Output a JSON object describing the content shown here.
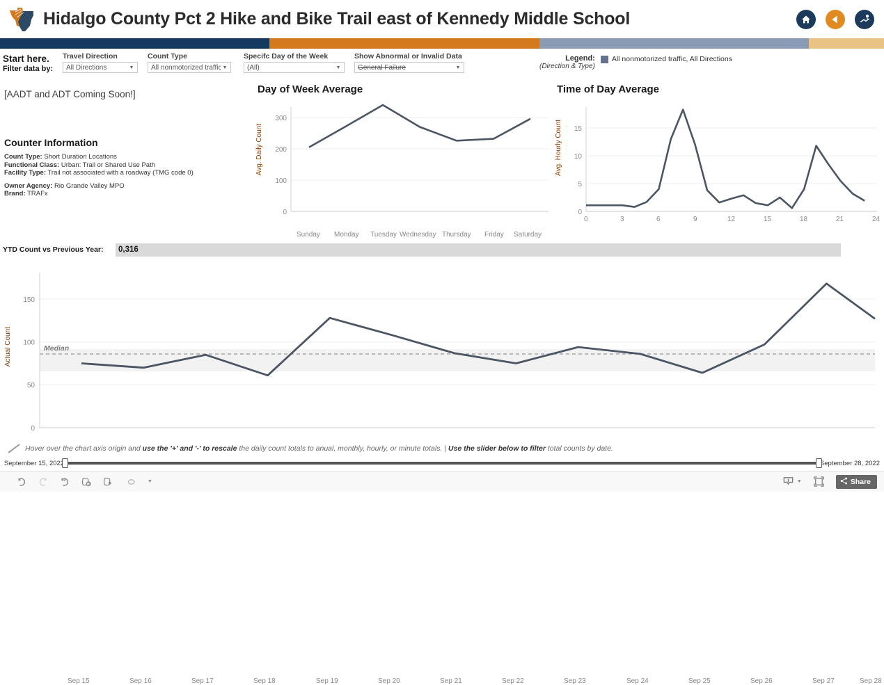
{
  "header": {
    "title": "Hidalgo County Pct 2 Hike and Bike Trail east of Kennedy Middle School",
    "logo_icon": "texas-state-icon",
    "icons": [
      {
        "name": "home-icon",
        "glyph": "home"
      },
      {
        "name": "back-arrow-icon",
        "glyph": "back"
      },
      {
        "name": "map-pin-icon",
        "glyph": "pin"
      }
    ],
    "strip_colors": [
      "#163a5f",
      "#d3791e",
      "#8a9cb5",
      "#e9c286"
    ]
  },
  "filters": {
    "start_here": "Start here.",
    "filter_data_by": "Filter data by:",
    "items": [
      {
        "label": "Travel Direction",
        "value": "All Directions",
        "strike": false
      },
      {
        "label": "Count Type",
        "value": "All nonmotorized traffic",
        "strike": false
      },
      {
        "label": "Specifc Day of the Week",
        "value": "(All)",
        "strike": false
      },
      {
        "label": "Show Abnormal or Invalid Data",
        "value": "General Failure",
        "strike": true
      }
    ]
  },
  "legend": {
    "title": "Legend:",
    "subtitle": "(Direction & Type)",
    "entry_label": "All nonmotorized traffic, All Directions",
    "entry_color": "#63738f"
  },
  "left_panel": {
    "aadt_note": "[AADT and ADT Coming Soon!]",
    "counter_info_title": "Counter Information",
    "rows": [
      {
        "key": "Count Type:",
        "val": " Short Duration Locations"
      },
      {
        "key": "Functional Class:",
        "val": " Urban: Trail or Shared Use Path"
      },
      {
        "key": "Facility Type:",
        "val": " Trail not associated with a roadway (TMG code 0)"
      },
      {
        "key": "Owner Agency:",
        "val": " Rio Grande Valley MPO"
      },
      {
        "key": "Brand:",
        "val": " TRAFx"
      }
    ]
  },
  "ytd": {
    "label": "YTD Count vs Previous Year:",
    "value": "0,316"
  },
  "hint": {
    "icon": "pencil-icon",
    "part1": "Hover over the chart axis origin and ",
    "bold1": "use the '+' and '-' to rescale",
    "part2": " the daily count totals to anual, monthly, hourly, or minute totals.  |  ",
    "bold2": "Use the slider below to filter",
    "part3": " total counts by date."
  },
  "slider": {
    "start_date": "September 15, 2022",
    "end_date": "September 28, 2022"
  },
  "toolbar": {
    "left_icons": [
      {
        "name": "undo-icon"
      },
      {
        "name": "redo-icon"
      },
      {
        "name": "revert-icon"
      },
      {
        "name": "refresh-icon"
      },
      {
        "name": "pause-icon"
      },
      {
        "name": "view-original-icon"
      }
    ],
    "right_icons": [
      {
        "name": "download-icon"
      },
      {
        "name": "fullscreen-icon"
      }
    ],
    "share_label": "Share",
    "share_icon": "share-icon"
  },
  "chart_data": [
    {
      "id": "day_of_week",
      "type": "line",
      "title": "Day of Week Average",
      "xlabel": "",
      "ylabel": "Avg. Daily Count",
      "categories": [
        "Sunday",
        "Monday",
        "Tuesday",
        "Wednesday",
        "Thursday",
        "Friday",
        "Saturday"
      ],
      "values": [
        205,
        272,
        340,
        270,
        226,
        232,
        296
      ],
      "yticks": [
        0,
        100,
        200,
        300
      ],
      "ylim": [
        0,
        350
      ],
      "grid": true,
      "line_color": "#4b5563",
      "legend": "none"
    },
    {
      "id": "time_of_day",
      "type": "line",
      "title": "Time of Day Average",
      "xlabel": "",
      "ylabel": "Avg. Hourly Count",
      "x": [
        0,
        1,
        2,
        3,
        4,
        5,
        6,
        7,
        8,
        9,
        10,
        11,
        12,
        13,
        14,
        15,
        16,
        17,
        18,
        19,
        20,
        21,
        22,
        23
      ],
      "values": [
        1.1,
        1.1,
        1.1,
        1.1,
        0.8,
        1.7,
        4.0,
        13.0,
        18.3,
        12.0,
        3.8,
        1.6,
        2.3,
        2.9,
        1.5,
        1.1,
        2.5,
        0.6,
        4.0,
        11.8,
        8.5,
        5.5,
        3.2,
        1.9
      ],
      "xticks": [
        0,
        3,
        6,
        9,
        12,
        15,
        18,
        21,
        24
      ],
      "yticks": [
        0,
        5,
        10,
        15
      ],
      "ylim": [
        0,
        19
      ],
      "xlim": [
        0,
        24
      ],
      "grid": true,
      "line_color": "#4b5563",
      "legend": "none"
    },
    {
      "id": "daily_actual_count",
      "type": "line",
      "title": "",
      "xlabel": "",
      "ylabel": "Actual Count",
      "categories": [
        "Sep 15",
        "Sep 16",
        "Sep 17",
        "Sep 18",
        "Sep 19",
        "Sep 20",
        "Sep 21",
        "Sep 22",
        "Sep 23",
        "Sep 24",
        "Sep 25",
        "Sep 26",
        "Sep 27",
        "Sep 28"
      ],
      "values": [
        75,
        70,
        85,
        61,
        128,
        108,
        87,
        75,
        94,
        86,
        64,
        97,
        168,
        127
      ],
      "yticks": [
        0,
        50,
        100,
        150
      ],
      "ylim": [
        0,
        180
      ],
      "grid": true,
      "line_color": "#4b5563",
      "reference_band": {
        "label": "Median",
        "value": 86,
        "lower": 75,
        "upper": 102,
        "band_color": "#f2f2f2",
        "line_color": "#aaaaaa"
      },
      "legend": "none"
    }
  ]
}
